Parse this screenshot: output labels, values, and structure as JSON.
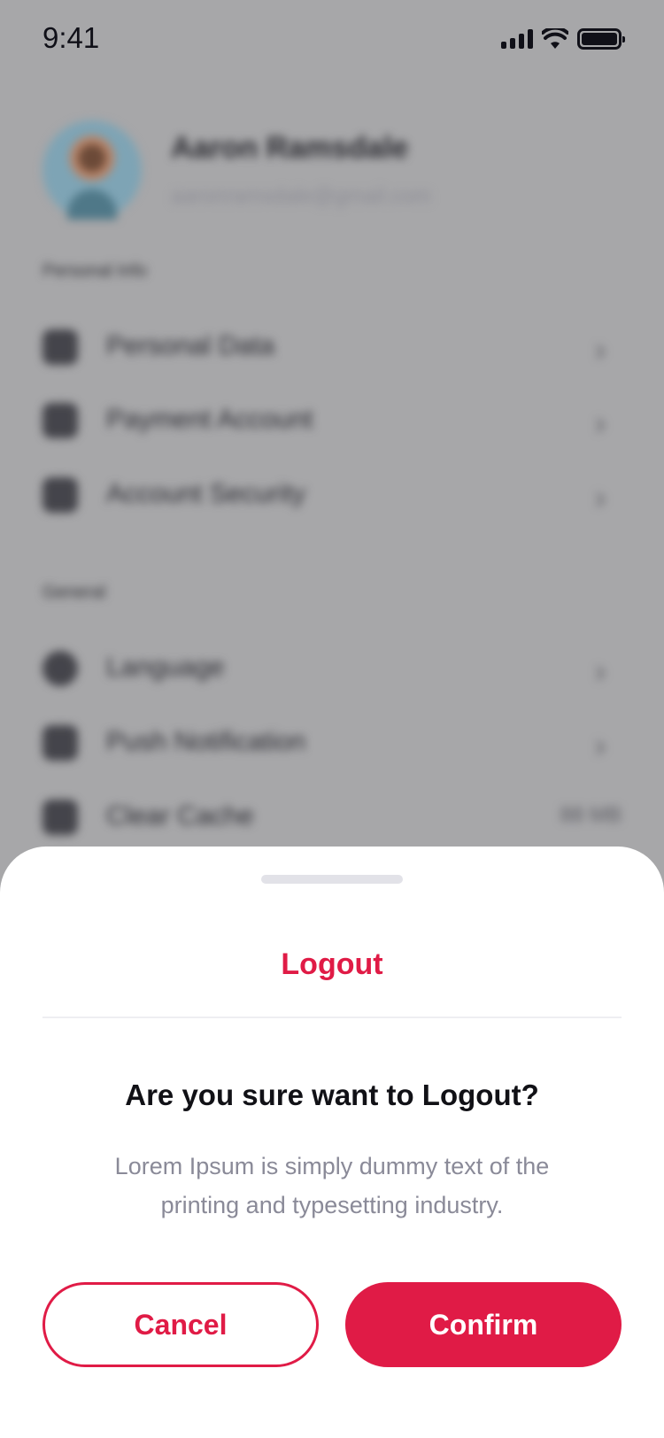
{
  "status_bar": {
    "time": "9:41"
  },
  "profile": {
    "name": "Aaron Ramsdale",
    "email": "aaronramsdale@gmail.com"
  },
  "sections": [
    {
      "label": "Personal Info",
      "items": [
        {
          "label": "Personal Data",
          "icon": "user-icon"
        },
        {
          "label": "Payment Account",
          "icon": "wallet-icon"
        },
        {
          "label": "Account Security",
          "icon": "shield-icon"
        }
      ]
    },
    {
      "label": "General",
      "items": [
        {
          "label": "Language",
          "icon": "globe-icon"
        },
        {
          "label": "Push Notification",
          "icon": "bell-icon"
        },
        {
          "label": "Clear Cache",
          "icon": "trash-icon",
          "value": "88 MB"
        }
      ]
    }
  ],
  "logout_sheet": {
    "title": "Logout",
    "question": "Are you sure want to Logout?",
    "description": "Lorem Ipsum is simply dummy text of the printing and typesetting industry.",
    "cancel_label": "Cancel",
    "confirm_label": "Confirm"
  },
  "colors": {
    "accent": "#E01B46",
    "overlay": "#A7A7A9",
    "text_dark": "#111116",
    "text_muted": "#8A8A98"
  }
}
